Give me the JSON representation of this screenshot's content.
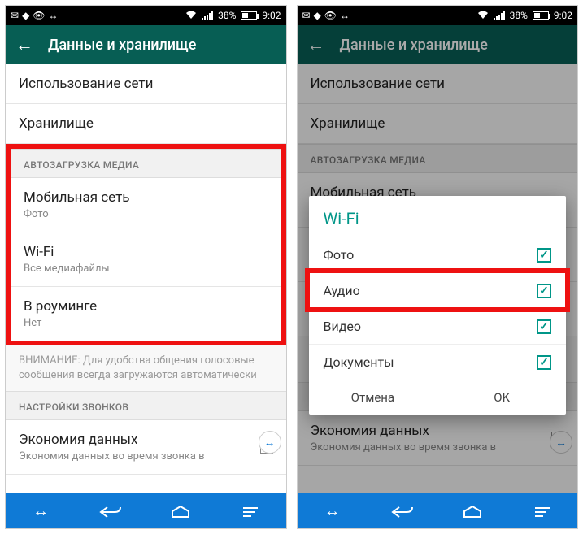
{
  "statusbar": {
    "battery_pct": "38%",
    "time": "9:02"
  },
  "appbar": {
    "title": "Данные и хранилище"
  },
  "left_screen": {
    "items": {
      "network_usage": "Использование сети",
      "storage": "Хранилище"
    },
    "autodl_header": "АВТОЗАГРУЗКА МЕДИА",
    "autodl": {
      "mobile_title": "Мобильная сеть",
      "mobile_sub": "Фото",
      "wifi_title": "Wi-Fi",
      "wifi_sub": "Все медиафайлы",
      "roaming_title": "В роуминге",
      "roaming_sub": "Нет"
    },
    "note": "ВНИМАНИЕ: Для удобства общения голосовые сообщения всегда загружаются автоматически",
    "calls_header": "НАСТРОЙКИ ЗВОНКОВ",
    "calls_item_title": "Экономия данных",
    "calls_item_sub": "Экономия данных во время звонка в"
  },
  "right_screen": {
    "dialog_title": "Wi-Fi",
    "options": {
      "photo": "Фото",
      "audio": "Аудио",
      "video": "Видео",
      "docs": "Документы"
    },
    "checked": {
      "photo": true,
      "audio": true,
      "video": true,
      "docs": true
    },
    "cancel": "Отмена",
    "ok": "OK"
  }
}
